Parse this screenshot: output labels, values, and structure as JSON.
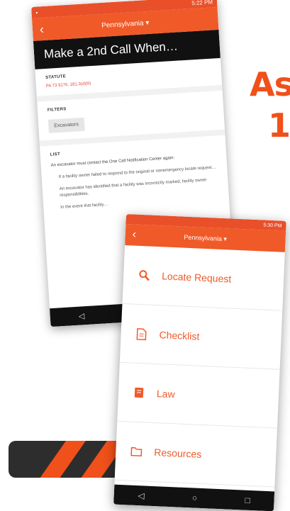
{
  "headline": {
    "line1": "As",
    "line2": "1"
  },
  "phone_back": {
    "status_time": "5:22 PM",
    "state": "Pennsylvania ▾",
    "title": "Make a 2nd Call When…",
    "statute_label": "STATUTE",
    "statute_value": "PA 73 §176, 181.3(d)(6)",
    "filters_label": "FILTERS",
    "filter_chip": "Excavators",
    "list_label": "LIST",
    "list_intro": "An excavator must contact the One Call Notification Center again:",
    "list_items": [
      "If a facility owner failed to respond to the original or nonemergency locate request…",
      "An excavator has identified that a facility was incorrectly marked, facility owner responsibilities.",
      "In the event that facility…"
    ],
    "nav": {
      "back": "◁",
      "home": "○",
      "recent": "□"
    }
  },
  "phone_front": {
    "status_time": "5:30 PM",
    "state": "Pennsylvania ▾",
    "menu": [
      {
        "label": "Locate Request",
        "icon": "search-icon"
      },
      {
        "label": "Checklist",
        "icon": "document-icon"
      },
      {
        "label": "Law",
        "icon": "book-icon"
      },
      {
        "label": "Resources",
        "icon": "folder-icon"
      }
    ],
    "nav": {
      "back": "◁",
      "home": "○",
      "recent": "□"
    }
  },
  "colors": {
    "brand": "#f05a28",
    "headline": "#f0501a",
    "dark": "#111111"
  }
}
